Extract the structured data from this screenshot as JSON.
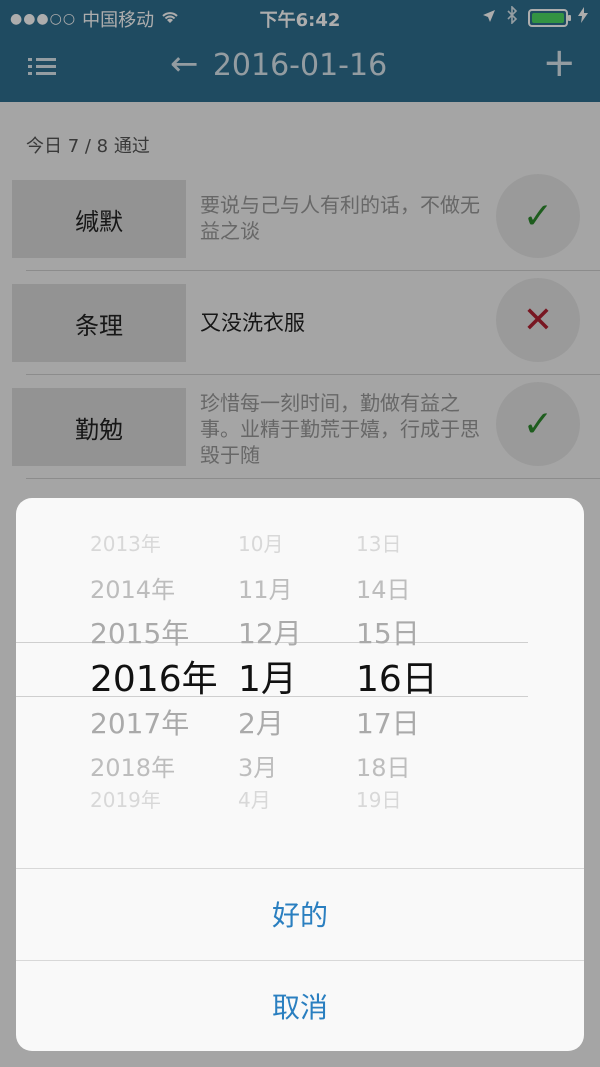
{
  "status": {
    "carrier": "中国移动",
    "time": "下午6:42",
    "signal_icon": "signal-dots-icon",
    "wifi_icon": "wifi-icon",
    "location_icon": "location-arrow-icon",
    "bluetooth_icon": "bluetooth-icon",
    "battery_icon": "battery-icon",
    "charging_icon": "charging-bolt-icon"
  },
  "nav": {
    "title": "2016-01-16",
    "menu_icon": "list-menu-icon",
    "back_icon": "left-arrow-icon",
    "add_icon": "plus-icon"
  },
  "summary": "今日 7 / 8 通过",
  "items": [
    {
      "name": "缄默",
      "description": "要说与己与人有利的话，不做无益之谈",
      "status": "check"
    },
    {
      "name": "条理",
      "description": "又没洗衣服",
      "status": "cross"
    },
    {
      "name": "勤勉",
      "description": "珍惜每一刻时间，勤做有益之事。业精于勤荒于嬉，行成于思毁于随",
      "status": "check"
    }
  ],
  "picker": {
    "years": [
      "2013年",
      "2014年",
      "2015年",
      "2016年",
      "2017年",
      "2018年",
      "2019年"
    ],
    "months": [
      "10月",
      "11月",
      "12月",
      "1月",
      "2月",
      "3月",
      "4月"
    ],
    "days": [
      "13日",
      "14日",
      "15日",
      "16日",
      "17日",
      "18日",
      "19日"
    ],
    "selected": {
      "year": "2016年",
      "month": "1月",
      "day": "16日"
    }
  },
  "actions": {
    "ok_label": "好的",
    "cancel_label": "取消"
  },
  "colors": {
    "nav_bar": "#2f6f8f",
    "action_text": "#2a7fc0",
    "check": "#2d8a2d",
    "cross": "#b22233"
  }
}
